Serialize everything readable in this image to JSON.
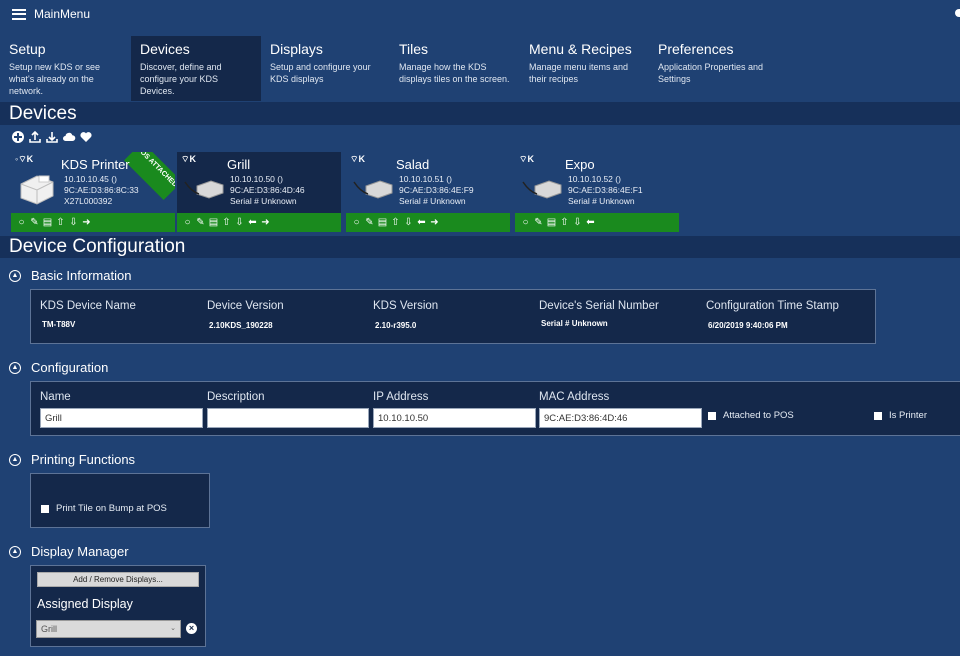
{
  "window": {
    "title": "MainMenu"
  },
  "nav": {
    "tabs": [
      {
        "label": "Setup",
        "desc": "Setup new KDS or see what's already on the network."
      },
      {
        "label": "Devices",
        "desc": "Discover, define and configure your KDS Devices."
      },
      {
        "label": "Displays",
        "desc": "Setup and configure your KDS displays"
      },
      {
        "label": "Tiles",
        "desc": "Manage how the KDS displays tiles on the screen."
      },
      {
        "label": "Menu & Recipes",
        "desc": "Manage menu items and their recipes"
      },
      {
        "label": "Preferences",
        "desc": "Application Properties and Settings"
      }
    ]
  },
  "devices_section": {
    "title": "Devices"
  },
  "toolbar_icons": [
    "add-icon",
    "upload-icon",
    "download-icon",
    "cloud-icon",
    "heart-icon"
  ],
  "devices": [
    {
      "name": "KDS Printer",
      "ip": "10.10.10.45 ()",
      "mac": "9C:AE:D3:86:8C:33",
      "extra": "X27L000392",
      "ribbon": "POS ATTACHED",
      "status": "◦⌔K"
    },
    {
      "name": "Grill",
      "ip": "10.10.10.50 ()",
      "mac": "9C:AE:D3:86:4D:46",
      "extra": "Serial # Unknown",
      "status": "⌔K"
    },
    {
      "name": "Salad",
      "ip": "10.10.10.51 ()",
      "mac": "9C:AE:D3:86:4E:F9",
      "extra": "Serial # Unknown",
      "status": "⌔K"
    },
    {
      "name": "Expo",
      "ip": "10.10.10.52 ()",
      "mac": "9C:AE:D3:86:4E:F1",
      "extra": "Serial # Unknown",
      "status": "⌔K"
    }
  ],
  "config_section": {
    "title": "Device Configuration"
  },
  "basic_info": {
    "header": "Basic Information",
    "device_name_label": "KDS Device Name",
    "device_name_value": "TM-T88V",
    "device_version_label": "Device Version",
    "device_version_value": "2.10KDS_190228",
    "kds_version_label": "KDS Version",
    "kds_version_value": "2.10-r395.0",
    "serial_label": "Device's Serial Number",
    "serial_value": "Serial # Unknown",
    "timestamp_label": "Configuration Time Stamp",
    "timestamp_value": "6/20/2019 9:40:06 PM"
  },
  "configuration": {
    "header": "Configuration",
    "name_label": "Name",
    "name_value": "Grill",
    "desc_label": "Description",
    "desc_value": "",
    "ip_label": "IP Address",
    "ip_value": "10.10.10.50",
    "mac_label": "MAC Address",
    "mac_value": "9C:AE:D3:86:4D:46",
    "attached_label": "Attached to POS",
    "printer_label": "Is Printer"
  },
  "printing": {
    "header": "Printing Functions",
    "print_tile_label": "Print Tile on Bump at POS"
  },
  "display_manager": {
    "header": "Display Manager",
    "add_remove_label": "Add / Remove Displays...",
    "assigned_label": "Assigned Display",
    "assigned_value": "Grill"
  }
}
